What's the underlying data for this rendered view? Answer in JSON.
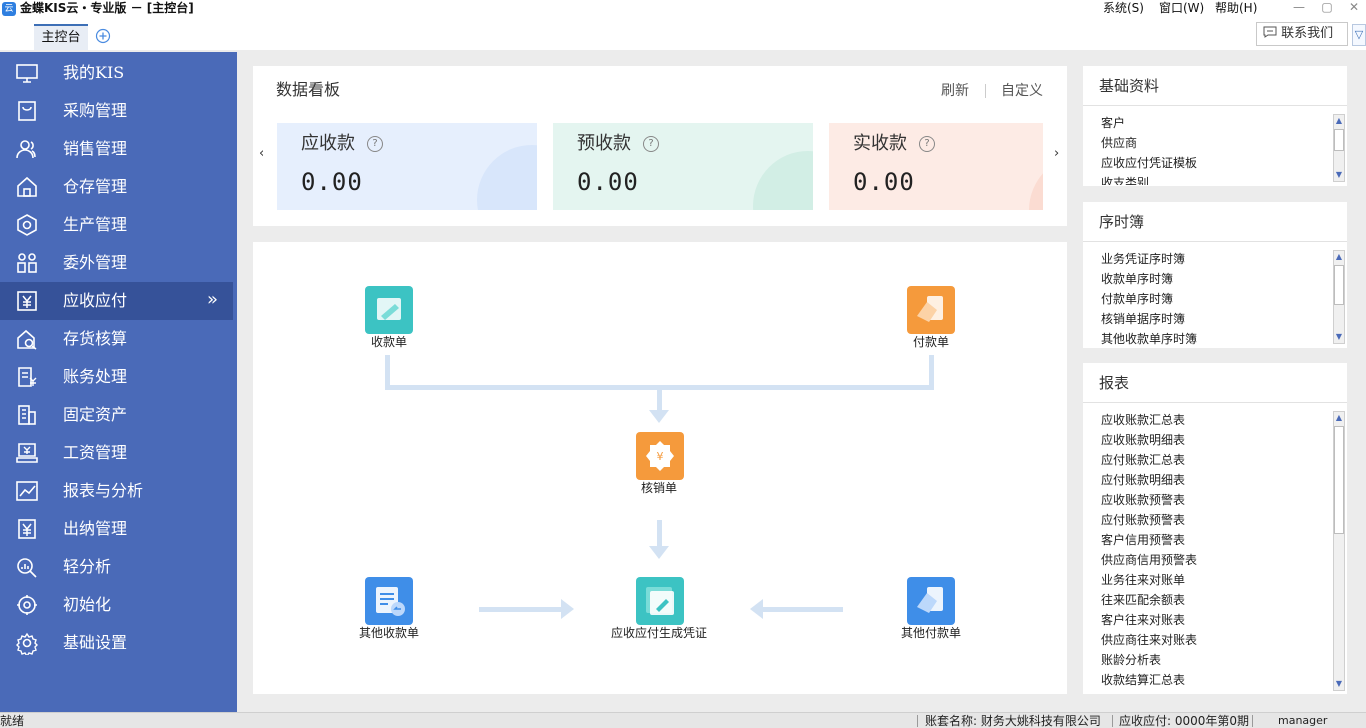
{
  "app": {
    "title": "金蝶KIS云・专业版 － [主控台]",
    "logo": "云",
    "menu": [
      "系统(S)",
      "窗口(W)",
      "帮助(H)"
    ],
    "window_buttons": [
      "—",
      "▢",
      "✕"
    ]
  },
  "tabs": {
    "active": "主控台",
    "add_icon": "plus-icon"
  },
  "contact": {
    "label": "联系我们",
    "icon": "chat-icon"
  },
  "sidebar": {
    "accent": "#4a6ab8",
    "active_index": 6,
    "items": [
      {
        "label": "我的KIS",
        "icon": "monitor-icon"
      },
      {
        "label": "采购管理",
        "icon": "purchase-icon"
      },
      {
        "label": "销售管理",
        "icon": "users-icon"
      },
      {
        "label": "仓存管理",
        "icon": "warehouse-icon"
      },
      {
        "label": "生产管理",
        "icon": "production-icon"
      },
      {
        "label": "委外管理",
        "icon": "outsource-icon"
      },
      {
        "label": "应收应付",
        "icon": "receivable-icon"
      },
      {
        "label": "存货核算",
        "icon": "inventory-icon"
      },
      {
        "label": "账务处理",
        "icon": "ledger-icon"
      },
      {
        "label": "固定资产",
        "icon": "building-icon"
      },
      {
        "label": "工资管理",
        "icon": "salary-icon"
      },
      {
        "label": "报表与分析",
        "icon": "chart-icon"
      },
      {
        "label": "出纳管理",
        "icon": "cashier-icon"
      },
      {
        "label": "轻分析",
        "icon": "analysis-icon"
      },
      {
        "label": "初始化",
        "icon": "init-icon"
      },
      {
        "label": "基础设置",
        "icon": "settings-icon"
      }
    ],
    "active_chevron": "»"
  },
  "dashboard": {
    "title": "数据看板",
    "refresh": "刷新",
    "customize": "自定义",
    "prev": "‹",
    "next": "›",
    "cards": [
      {
        "title": "应收款",
        "value": "0.00",
        "help": "?",
        "color": "#e6effd"
      },
      {
        "title": "预收款",
        "value": "0.00",
        "help": "?",
        "color": "#e4f5f0"
      },
      {
        "title": "实收款",
        "value": "0.00",
        "help": "?",
        "color": "#fdebe5"
      }
    ]
  },
  "flow": {
    "nodes": [
      {
        "label": "收款单",
        "icon": "receipt-icon",
        "color": "#3cc3c3"
      },
      {
        "label": "付款单",
        "icon": "payment-icon",
        "color": "#f59a3c"
      },
      {
        "label": "核销单",
        "icon": "writeoff-icon",
        "color": "#f59a3c"
      },
      {
        "label": "其他收款单",
        "icon": "other-receipt-icon",
        "color": "#3f8ee8"
      },
      {
        "label": "应收应付生成凭证",
        "icon": "voucher-icon",
        "color": "#3cc3c3"
      },
      {
        "label": "其他付款单",
        "icon": "other-payment-icon",
        "color": "#3f8ee8"
      }
    ]
  },
  "basic_data": {
    "title": "基础资料",
    "items": [
      "客户",
      "供应商",
      "应收应付凭证模板",
      "收支类别"
    ]
  },
  "sequence_book": {
    "title": "序时簿",
    "items": [
      "业务凭证序时簿",
      "收款单序时簿",
      "付款单序时簿",
      "核销单据序时簿",
      "其他收款单序时簿"
    ]
  },
  "reports": {
    "title": "报表",
    "items": [
      "应收账款汇总表",
      "应收账款明细表",
      "应付账款汇总表",
      "应付账款明细表",
      "应收账款预警表",
      "应付账款预警表",
      "客户信用预警表",
      "供应商信用预警表",
      "业务往来对账单",
      "往来匹配余额表",
      "客户往来对账表",
      "供应商往来对账表",
      "账龄分析表",
      "收款结算汇总表"
    ]
  },
  "status": {
    "left": "就绪",
    "account": "账套名称: 财务大姚科技有限公司",
    "module": "应收应付: 0000年第0期",
    "user": "manager"
  }
}
